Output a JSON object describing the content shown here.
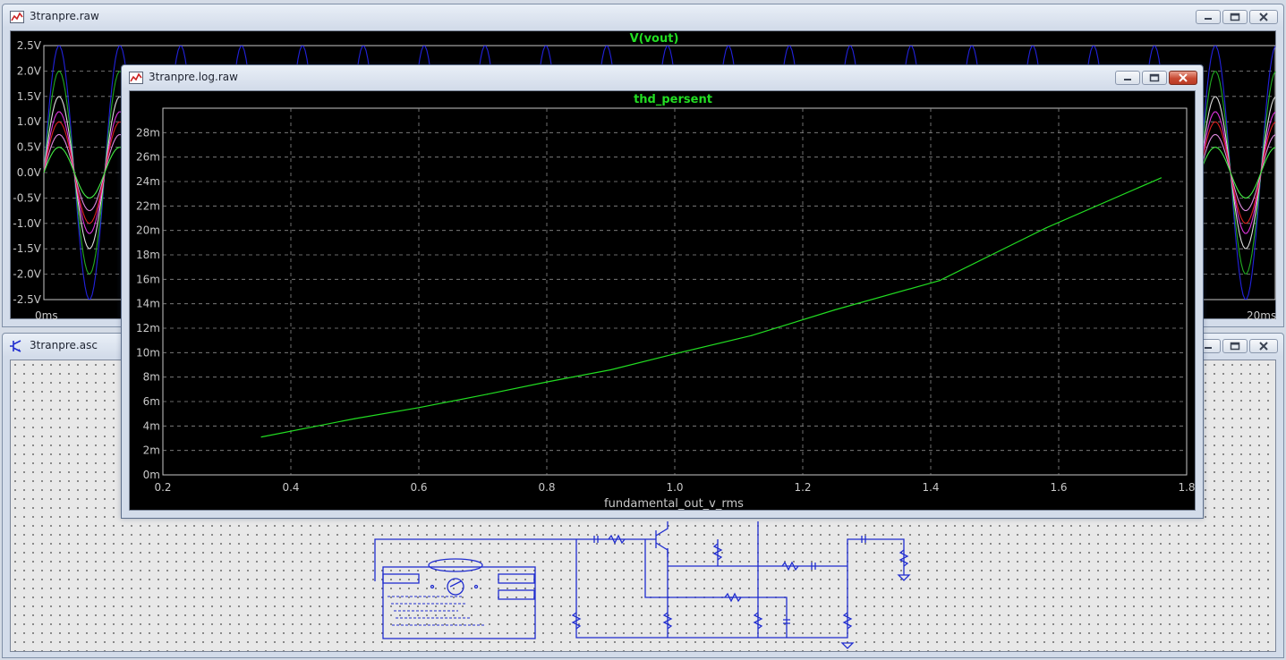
{
  "windows": {
    "transient": {
      "title": "3tranpre.raw"
    },
    "schematic": {
      "title": "3tranpre.asc"
    },
    "log": {
      "title": "3tranpre.log.raw"
    }
  },
  "colors": {
    "plot_bg": "#000000",
    "trace_label": "#22dd22",
    "axis_text": "#c8c8c8",
    "grid": "#8c8c8c",
    "thd_trace": "#22dd22",
    "wire": "#1f2ccf",
    "wave_colors": [
      "#2222dd",
      "#22aa22",
      "#dddddd",
      "#dd33dd",
      "#dd2222",
      "#dd88dd",
      "#44ee44"
    ]
  },
  "icons": {
    "raw_window": "waveform-icon",
    "schematic_window": "transistor-icon",
    "minimize": "minimize-icon",
    "maximize": "maximize-icon",
    "close": "close-icon"
  },
  "transient_plot": {
    "trace_label": "V(vout)",
    "y_ticks": [
      "2.5V",
      "2.0V",
      "1.5V",
      "1.0V",
      "0.5V",
      "0.0V",
      "-0.5V",
      "-1.0V",
      "-1.5V",
      "-2.0V",
      "-2.5V"
    ],
    "x_start_label": "0ms",
    "x_end_label": "20ms"
  },
  "chart_data": {
    "type": "line",
    "title": "thd_persent",
    "xlabel": "fundamental_out_v_rms",
    "ylabel": "",
    "x_ticks": [
      "0.2",
      "0.4",
      "0.6",
      "0.8",
      "1.0",
      "1.2",
      "1.4",
      "1.6",
      "1.8"
    ],
    "y_ticks": [
      "0m",
      "2m",
      "4m",
      "6m",
      "8m",
      "10m",
      "12m",
      "14m",
      "16m",
      "18m",
      "20m",
      "22m",
      "24m",
      "26m",
      "28m"
    ],
    "xlim": [
      0.2,
      1.8
    ],
    "ylim": [
      0,
      0.03
    ],
    "grid": true,
    "series": [
      {
        "name": "thd_persent",
        "x": [
          0.354,
          0.5,
          0.6,
          0.707,
          0.8,
          0.9,
          1.0,
          1.12,
          1.25,
          1.414,
          1.58,
          1.76
        ],
        "y": [
          0.0031,
          0.0046,
          0.0055,
          0.0066,
          0.0076,
          0.0086,
          0.0099,
          0.0114,
          0.0135,
          0.0159,
          0.0202,
          0.0243
        ]
      }
    ]
  }
}
